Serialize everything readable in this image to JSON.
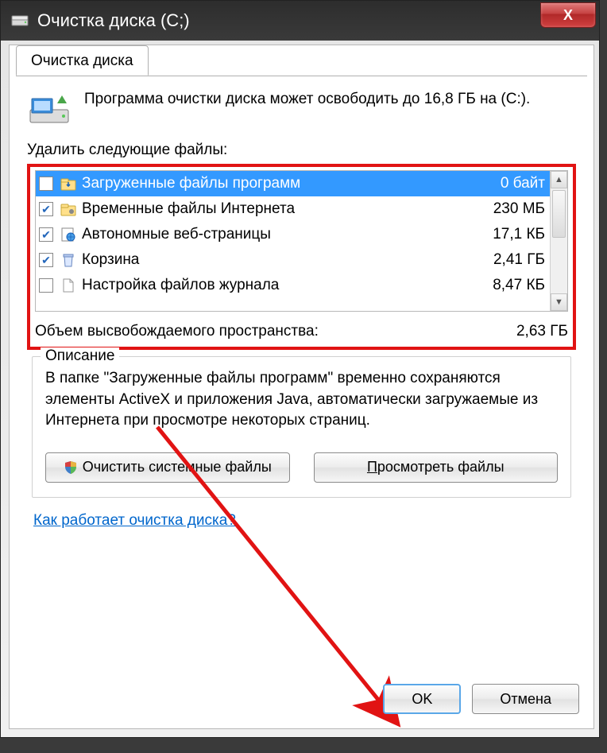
{
  "window": {
    "title": "Очистка диска (C;)",
    "close": "X"
  },
  "tab": {
    "label": "Очистка диска"
  },
  "intro": {
    "text": "Программа очистки диска может освободить до 16,8 ГБ на (C:)."
  },
  "list": {
    "header": "Удалить следующие файлы:",
    "items": [
      {
        "checked": false,
        "name": "Загруженные файлы программ",
        "size": "0 байт",
        "selected": true,
        "icon": "folder-download"
      },
      {
        "checked": true,
        "name": "Временные файлы Интернета",
        "size": "230 МБ",
        "selected": false,
        "icon": "folder-gear"
      },
      {
        "checked": true,
        "name": "Автономные веб-страницы",
        "size": "17,1 КБ",
        "selected": false,
        "icon": "globe-page"
      },
      {
        "checked": true,
        "name": "Корзина",
        "size": "2,41 ГБ",
        "selected": false,
        "icon": "recycle-bin"
      },
      {
        "checked": false,
        "name": "Настройка файлов журнала",
        "size": "8,47 КБ",
        "selected": false,
        "icon": "file"
      }
    ]
  },
  "summary": {
    "label": "Объем высвобождаемого пространства:",
    "value": "2,63 ГБ"
  },
  "description": {
    "legend": "Описание",
    "text": "В папке \"Загруженные файлы программ\" временно сохраняются элементы ActiveX и приложения Java, автоматически загружаемые из Интернета при просмотре некоторых страниц."
  },
  "buttons": {
    "clean_system": "Очистить системные файлы",
    "view_files": "Просмотреть файлы",
    "view_files_accel": "П"
  },
  "help_link": "Как работает очистка диска?",
  "dialog": {
    "ok": "OK",
    "cancel": "Отмена"
  }
}
